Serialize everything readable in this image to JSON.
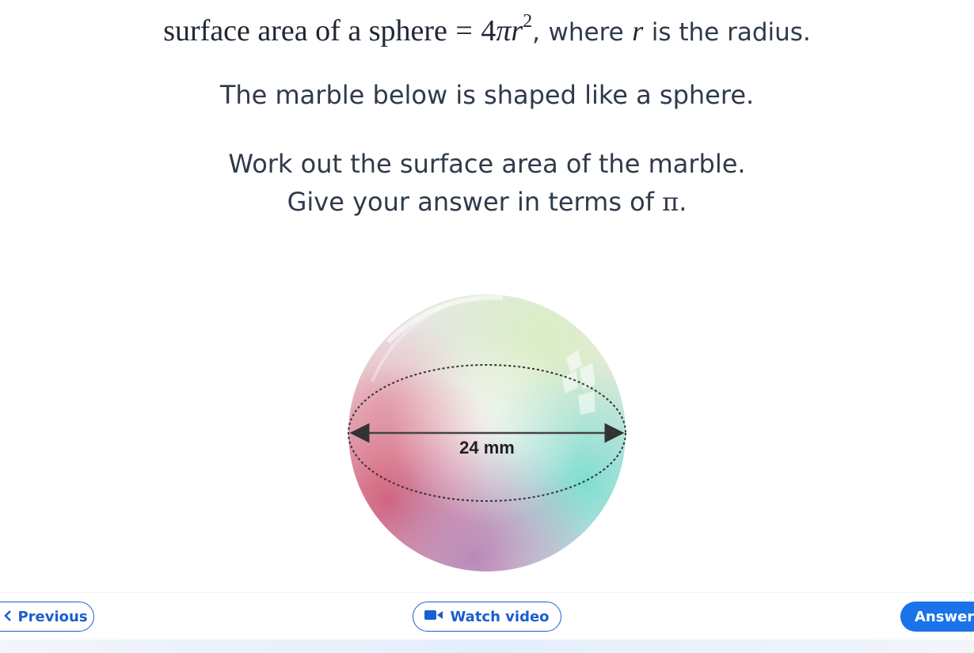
{
  "formula": {
    "lhs": "surface area of a sphere",
    "equals": "=",
    "coefficient": "4",
    "pi": "π",
    "variable": "r",
    "exponent": "2",
    "comma": ",",
    "where_text": "where",
    "where_variable": "r",
    "where_tail": "is the radius."
  },
  "question": {
    "line1": "The marble below is shaped like a sphere.",
    "line2": "Work out the surface area of the marble.",
    "line3_prefix": "Give your answer in terms of",
    "line3_pi": "π",
    "line3_suffix": "."
  },
  "diagram": {
    "diameter_label": "24 mm"
  },
  "nav": {
    "previous_label": "Previous",
    "watch_label": "Watch video",
    "answer_label": "Answer"
  },
  "colors": {
    "primary": "#1a5fd0",
    "answer_bg": "#1a73e8",
    "text": "#2f3a4a"
  },
  "icons": {
    "previous": "chevron-left-icon",
    "watch": "video-camera-icon"
  }
}
